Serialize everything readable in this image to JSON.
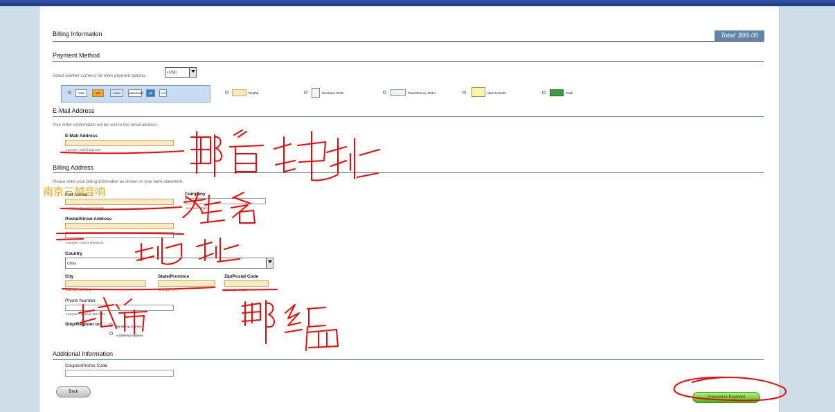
{
  "header": {
    "title": "Billing Information",
    "total": "Total: $99.00"
  },
  "payment": {
    "title": "Payment Method",
    "currency_hint": "Select another currency for more payment options:",
    "currency_value": "• USD",
    "cards": [
      "VISA",
      "MC",
      "AMEX",
      "DISCOVER",
      "AE",
      "JCB"
    ],
    "options": [
      "PayPal",
      "Purchase Order",
      "Check/Money Order",
      "Wire Transfer",
      "Cash"
    ]
  },
  "email": {
    "title": "E-Mail Address",
    "hint": "Your order confirmation will be sent to this email address.",
    "label": "E-Mail Address",
    "example": "example: help@fagil.com"
  },
  "billing": {
    "title": "Billing Address",
    "hint": "Please enter your billing information as shown on your bank statement.",
    "full_name_label": "Full Name",
    "full_name_example": "example: Benjamin Franklin",
    "company_label": "Company",
    "company_example": "example: Fagil",
    "street_label": "Postal/Street Address",
    "street_example": "example: 1443-3 Walnut St.",
    "country_label": "Country",
    "country_value": "China",
    "city_label": "City",
    "city_example": "example: Berkeley",
    "state_label": "State/Province",
    "state_example": "example: CA",
    "zip_label": "Zip/Postal Code",
    "zip_example": "example: 94709",
    "phone_label": "Phone Number",
    "phone_example": "example: +1 (123) 456-7891",
    "ship_label": "Ship/Register to:",
    "ship_opt1": "My Billing Address",
    "ship_opt2": "A Different Address"
  },
  "additional": {
    "title": "Additional Information",
    "coupon_label": "Coupon/Promo Code"
  },
  "buttons": {
    "back": "Back",
    "proceed": "Proceed to Payment"
  },
  "annotations": {
    "overlay_text": "南京三越音响",
    "marks": [
      "邮箱地址",
      "姓名",
      "地址",
      "城市",
      "邮编"
    ],
    "colors": {
      "ink": "#ff0000",
      "overlay": "#f2a310",
      "total_bg": "#5f84a9",
      "proceed": "#45b51c"
    }
  }
}
